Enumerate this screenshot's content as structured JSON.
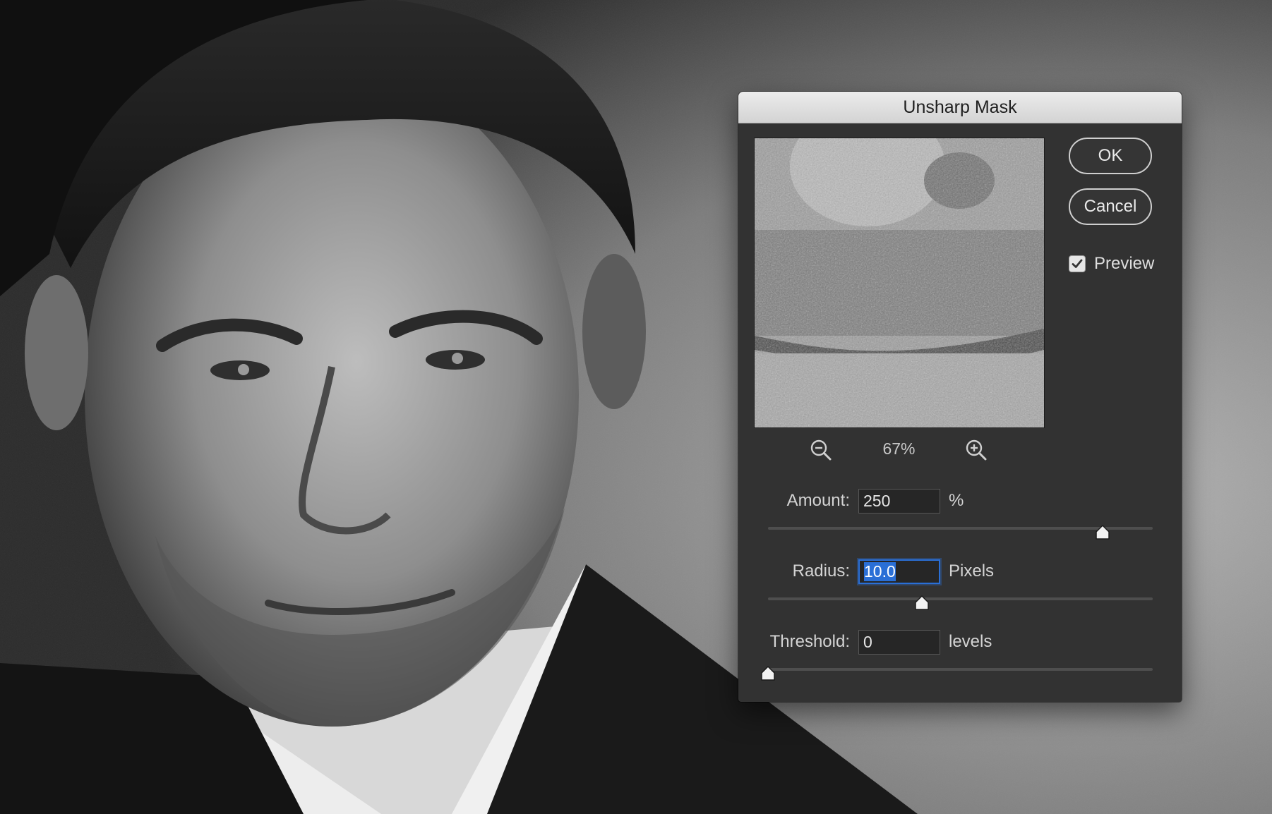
{
  "dialog": {
    "title": "Unsharp Mask",
    "ok_label": "OK",
    "cancel_label": "Cancel",
    "preview_label": "Preview",
    "preview_checked": true,
    "zoom": {
      "level": "67%",
      "zoom_out_icon": "zoom-out-icon",
      "zoom_in_icon": "zoom-in-icon"
    },
    "amount": {
      "label": "Amount:",
      "value": "250",
      "unit": "%",
      "slider_fraction": 0.87
    },
    "radius": {
      "label": "Radius:",
      "value": "10.0",
      "unit": "Pixels",
      "slider_fraction": 0.4,
      "focused": true
    },
    "threshold": {
      "label": "Threshold:",
      "value": "0",
      "unit": "levels",
      "slider_fraction": 0.0
    }
  },
  "colors": {
    "dialog_background": "#323232",
    "titlebar": "#dcdcdc",
    "focus_ring": "#2a6fd6"
  }
}
